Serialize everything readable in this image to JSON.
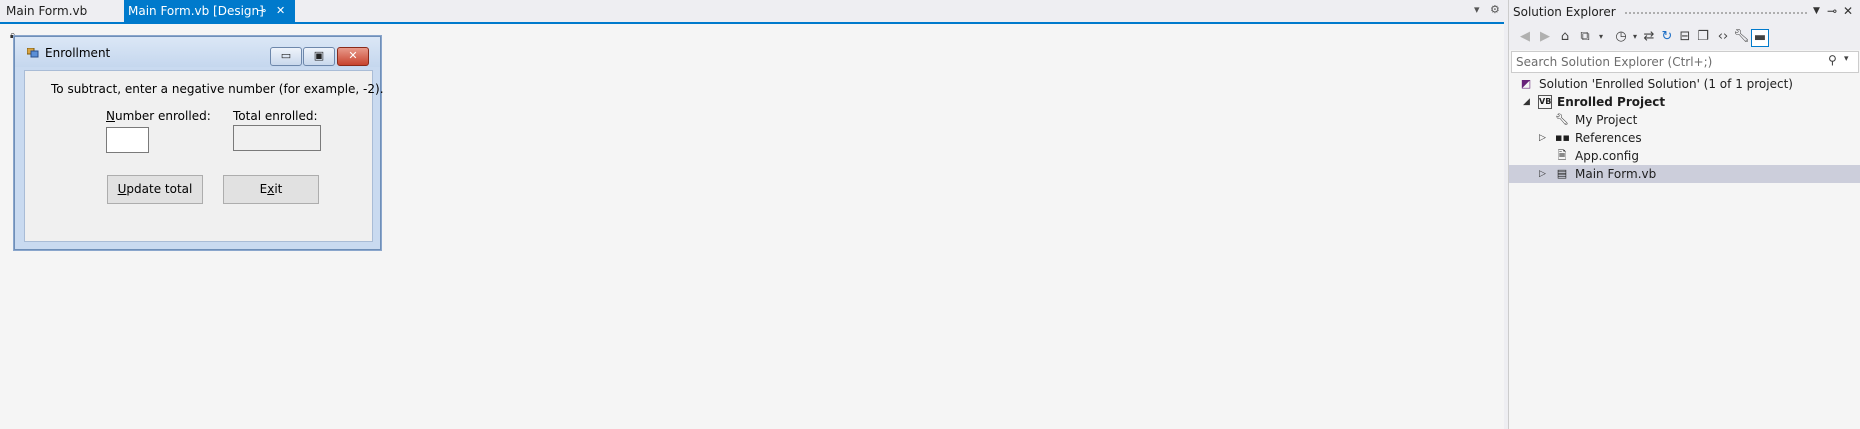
{
  "tabs": [
    {
      "label": "Main Form.vb"
    },
    {
      "label": "Main Form.vb [Design]"
    }
  ],
  "form": {
    "title": "Enrollment",
    "instruction": "To subtract, enter a negative number (for example, -2).",
    "number_enrolled_label": {
      "accel": "N",
      "rest": "umber enrolled:"
    },
    "total_enrolled_label": "Total enrolled:",
    "update_button": {
      "accel": "U",
      "rest": "pdate total"
    },
    "exit_button": {
      "pre": "E",
      "accel": "x",
      "rest": "it"
    }
  },
  "solution_explorer": {
    "title": "Solution Explorer",
    "search_placeholder": "Search Solution Explorer (Ctrl+;)",
    "tree": {
      "solution": "Solution 'Enrolled Solution' (1 of 1 project)",
      "project": "Enrolled Project",
      "items": [
        "My Project",
        "References",
        "App.config",
        "Main Form.vb"
      ]
    }
  },
  "colors": {
    "accent": "#007acc",
    "selection": "#cccedb"
  }
}
